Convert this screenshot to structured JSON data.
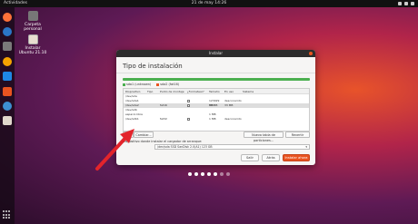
{
  "topbar": {
    "activities": "Actividades",
    "clock": "21 de may 14:26"
  },
  "desktop": {
    "icons": [
      {
        "label": "Carpeta personal"
      },
      {
        "label": "Instalar Ubuntu 21.10"
      }
    ]
  },
  "window": {
    "title": "Instalar",
    "heading": "Tipo de instalación",
    "legend": [
      {
        "label": "sda1 (unknown)",
        "color": "#4caf50"
      },
      {
        "label": "sda2 (fat16)",
        "color": "#e95420"
      }
    ],
    "table": {
      "headers": [
        "Dispositivo",
        "Tipo",
        "Punto de montaje",
        "¿Formatear?",
        "Tamaño",
        "En uso",
        "Sistema"
      ],
      "rows": [
        {
          "device": "/dev/sda",
          "type": "",
          "mount": "",
          "size": "",
          "used": "",
          "system": ""
        },
        {
          "device": "/dev/sda1",
          "type": "",
          "mount": "",
          "size": "123029 MB",
          "used": "desconocido",
          "system": ""
        },
        {
          "device": "/dev/sda2",
          "type": "fat16",
          "mount": "",
          "size": "33 MB",
          "used": "33 MB",
          "system": ""
        },
        {
          "device": "/dev/sdb",
          "type": "",
          "mount": "",
          "size": "",
          "used": "",
          "system": ""
        },
        {
          "device": "espacio libre",
          "type": "",
          "mount": "",
          "size": "1 MB",
          "used": "",
          "system": ""
        },
        {
          "device": "/dev/sdb1",
          "type": "fat32",
          "mount": "",
          "size": "1 MB",
          "used": "desconocido",
          "system": ""
        }
      ]
    },
    "buttons": {
      "add": "+",
      "remove": "−",
      "change": "Cambiar...",
      "new_table": "Nueva tabla de particiones...",
      "revert": "Revertir"
    },
    "boot_label": "Dispositivo donde instalar el cargador de arranque:",
    "boot_value": "/dev/sda   SSD SanDisk 2.0(A1) 123 GB",
    "nav": {
      "quit": "Salir",
      "back": "Atrás",
      "install": "Instalar ahora"
    }
  },
  "progress_dots": {
    "total": 7,
    "done": 5
  },
  "colors": {
    "accent": "#e95420",
    "arrow": "#e3242b"
  }
}
